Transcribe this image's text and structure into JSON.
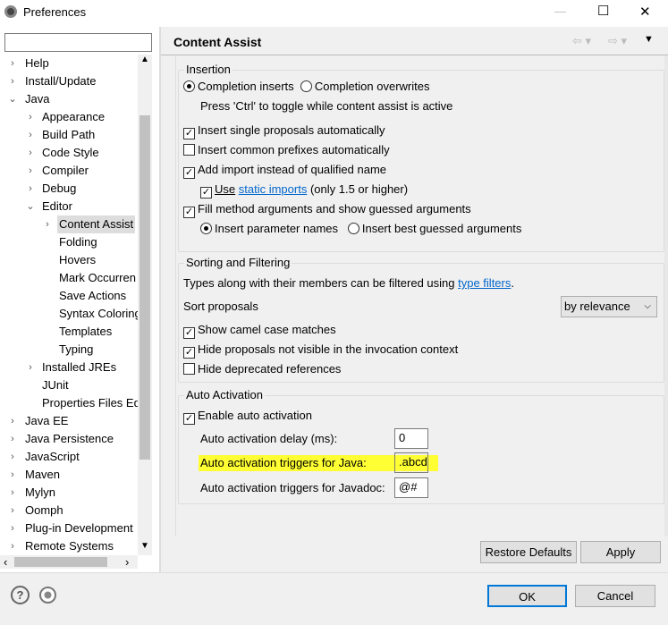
{
  "window": {
    "title": "Preferences",
    "minimize": "—",
    "maximize": "☐",
    "close": "✕"
  },
  "tree": {
    "search_value": "",
    "items": [
      {
        "label": "Help",
        "level": 0,
        "arrow": ">"
      },
      {
        "label": "Install/Update",
        "level": 0,
        "arrow": ">"
      },
      {
        "label": "Java",
        "level": 0,
        "arrow": "v"
      },
      {
        "label": "Appearance",
        "level": 1,
        "arrow": ">"
      },
      {
        "label": "Build Path",
        "level": 1,
        "arrow": ">"
      },
      {
        "label": "Code Style",
        "level": 1,
        "arrow": ">"
      },
      {
        "label": "Compiler",
        "level": 1,
        "arrow": ">"
      },
      {
        "label": "Debug",
        "level": 1,
        "arrow": ">"
      },
      {
        "label": "Editor",
        "level": 1,
        "arrow": "v"
      },
      {
        "label": "Content Assist",
        "level": 2,
        "arrow": ">",
        "selected": true
      },
      {
        "label": "Folding",
        "level": 2,
        "arrow": ""
      },
      {
        "label": "Hovers",
        "level": 2,
        "arrow": ""
      },
      {
        "label": "Mark Occurren",
        "level": 2,
        "arrow": ""
      },
      {
        "label": "Save Actions",
        "level": 2,
        "arrow": ""
      },
      {
        "label": "Syntax Coloring",
        "level": 2,
        "arrow": ""
      },
      {
        "label": "Templates",
        "level": 2,
        "arrow": ""
      },
      {
        "label": "Typing",
        "level": 2,
        "arrow": ""
      },
      {
        "label": "Installed JREs",
        "level": 1,
        "arrow": ">"
      },
      {
        "label": "JUnit",
        "level": 1,
        "arrow": ""
      },
      {
        "label": "Properties Files Ed",
        "level": 1,
        "arrow": ""
      },
      {
        "label": "Java EE",
        "level": 0,
        "arrow": ">"
      },
      {
        "label": "Java Persistence",
        "level": 0,
        "arrow": ">"
      },
      {
        "label": "JavaScript",
        "level": 0,
        "arrow": ">"
      },
      {
        "label": "Maven",
        "level": 0,
        "arrow": ">"
      },
      {
        "label": "Mylyn",
        "level": 0,
        "arrow": ">"
      },
      {
        "label": "Oomph",
        "level": 0,
        "arrow": ">"
      },
      {
        "label": "Plug-in Development",
        "level": 0,
        "arrow": ">"
      },
      {
        "label": "Remote Systems",
        "level": 0,
        "arrow": ">"
      }
    ]
  },
  "page": {
    "title": "Content Assist",
    "insertion": {
      "label": "Insertion",
      "completion_inserts": "Completion inserts",
      "completion_overwrites": "Completion overwrites",
      "toggle_hint": "Press 'Ctrl' to toggle while content assist is active",
      "insert_single": "Insert single proposals automatically",
      "insert_common": "Insert common prefixes automatically",
      "add_import": "Add import instead of qualified name",
      "use": "Use",
      "static_imports": "static imports",
      "only15": "(only 1.5 or higher)",
      "fill_args": "Fill method arguments and show guessed arguments",
      "insert_param_names": "Insert parameter names",
      "insert_best": "Insert best guessed arguments"
    },
    "sorting": {
      "label": "Sorting and Filtering",
      "types_text": "Types along with their members can be filtered using",
      "type_filters": "type filters",
      "period": ".",
      "sort_proposals": "Sort proposals",
      "sort_value": "by relevance",
      "camel": "Show camel case matches",
      "hide_not_visible": "Hide proposals not visible in the invocation context",
      "hide_deprecated": "Hide deprecated references"
    },
    "auto": {
      "label": "Auto Activation",
      "enable": "Enable auto activation",
      "delay_label": "Auto activation delay (ms):",
      "delay_value": "0",
      "java_label": "Auto activation triggers for Java:",
      "java_value": ".abcd",
      "javadoc_label": "Auto activation triggers for Javadoc:",
      "javadoc_value": "@#",
      "highlight_color": "#ffff33"
    },
    "restore_defaults": "Restore Defaults",
    "apply": "Apply"
  },
  "footer": {
    "ok": "OK",
    "cancel": "Cancel"
  }
}
